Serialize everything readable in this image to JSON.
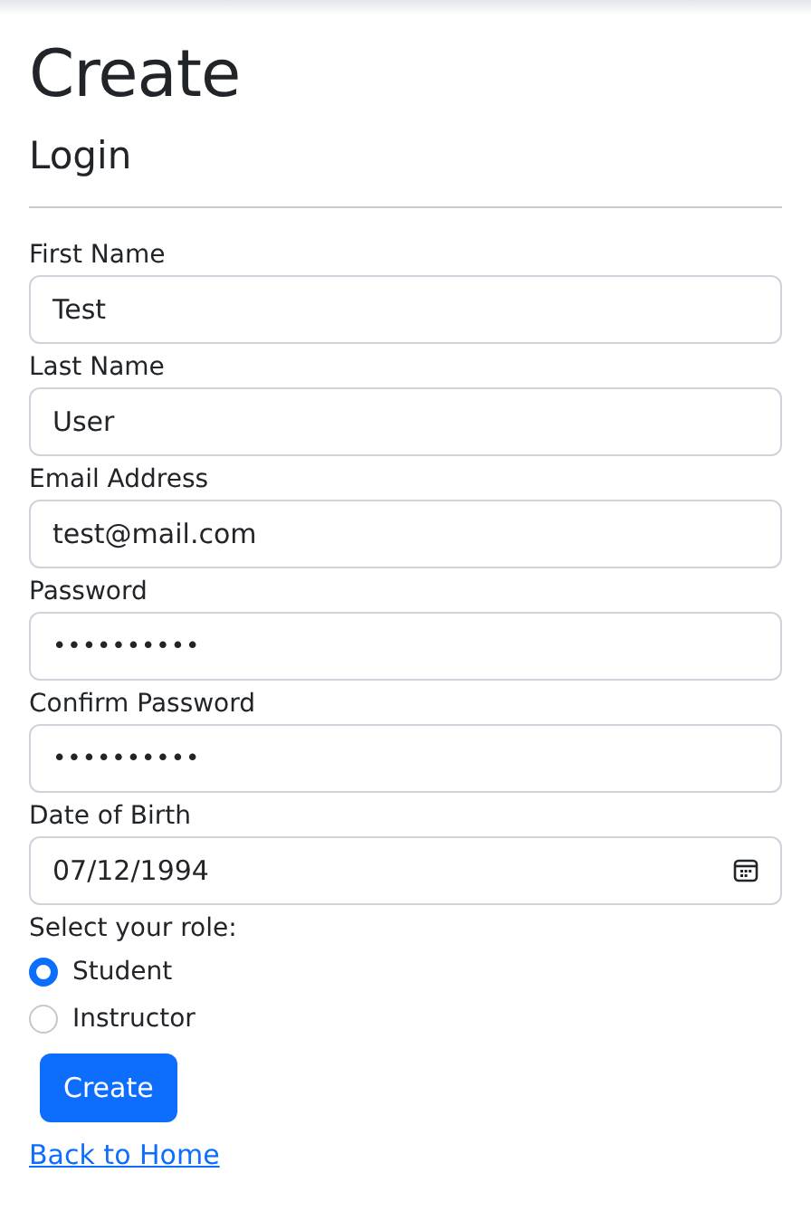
{
  "title": "Create",
  "subtitle": "Login",
  "fields": [
    {
      "label": "First Name",
      "value": "Test",
      "kind": "text"
    },
    {
      "label": "Last Name",
      "value": "User",
      "kind": "text"
    },
    {
      "label": "Email Address",
      "value": "test@mail.com",
      "kind": "text"
    },
    {
      "label": "Password",
      "value": "••••••••••",
      "kind": "password"
    },
    {
      "label": "Confirm Password",
      "value": "••••••••••",
      "kind": "password"
    },
    {
      "label": "Date of Birth",
      "value": "07/12/1994",
      "kind": "date"
    }
  ],
  "role": {
    "label": "Select your role:",
    "options": [
      {
        "label": "Student",
        "selected": true
      },
      {
        "label": "Instructor",
        "selected": false
      }
    ]
  },
  "submit": "Create",
  "back_link": "Back to Home"
}
